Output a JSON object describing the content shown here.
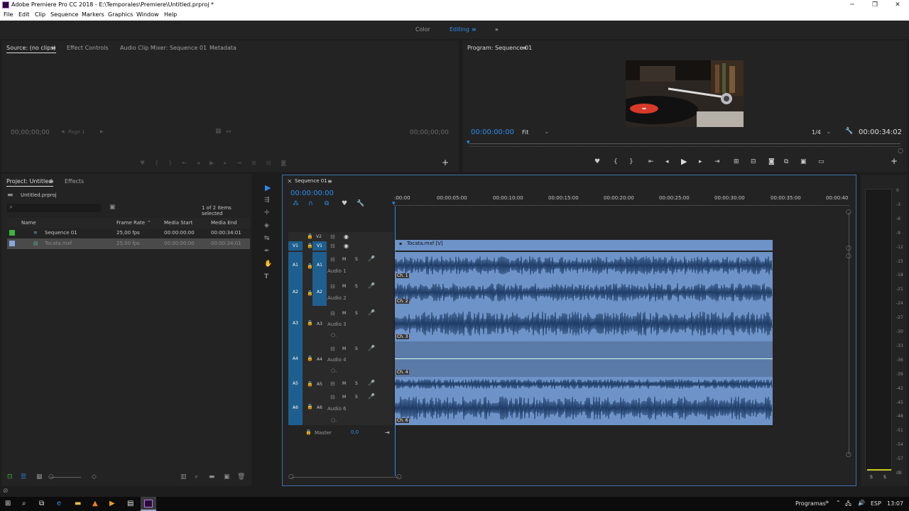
{
  "window": {
    "title": "Adobe Premiere Pro CC 2018 - E:\\Temporales\\Premiere\\Untitled.prproj *"
  },
  "menu": [
    "File",
    "Edit",
    "Clip",
    "Sequence",
    "Markers",
    "Graphics",
    "Window",
    "Help"
  ],
  "workspaces": {
    "color": "Color",
    "editing": "Editing"
  },
  "source": {
    "tabs": [
      "Source: (no clips)",
      "Effect Controls",
      "Audio Clip Mixer: Sequence 01",
      "Metadata"
    ],
    "tc_left": "00;00;00;00",
    "tc_right": "00;00;00;00",
    "page": "Page 1"
  },
  "program": {
    "tab": "Program: Sequence 01",
    "tc_left": "00:00:00:00",
    "fit": "Fit",
    "quality": "1/4",
    "tc_right": "00:00:34:02"
  },
  "project": {
    "tabs": [
      "Project: Untitled",
      "Effects"
    ],
    "file": "Untitled.prproj",
    "count": "1 of 2 items selected",
    "columns": [
      "Name",
      "Frame Rate",
      "Media Start",
      "Media End"
    ],
    "rows": [
      {
        "name": "Sequence 01",
        "rate": "25,00 fps",
        "start": "00:00:00:00",
        "end": "00:00:34:01"
      },
      {
        "name": "Tocata.mxf",
        "rate": "25,00 fps",
        "start": "00:00:00:00",
        "end": "00:00:34:01"
      }
    ]
  },
  "timeline": {
    "tab": "Sequence 01",
    "tc": "00:00:00:00",
    "ruler": [
      ":00:00",
      "00:00:05:00",
      "00:00:10:00",
      "00:00:15:00",
      "00:00:20:00",
      "00:00:25:00",
      "00:00:30:00",
      "00:00:35:00",
      "00:00:40"
    ],
    "video": [
      {
        "src": "",
        "tgt": "V2"
      },
      {
        "src": "V1",
        "tgt": "V1"
      }
    ],
    "audio": [
      {
        "src": "A1",
        "tgt": "A1",
        "name": "Audio 1"
      },
      {
        "src": "A2",
        "tgt": "A2",
        "name": "Audio 2"
      },
      {
        "src": "A3",
        "tgt": "A3",
        "name": "Audio 3"
      },
      {
        "src": "A4",
        "tgt": "A4",
        "name": "Audio 4"
      },
      {
        "src": "A5",
        "tgt": "A5",
        "name": ""
      },
      {
        "src": "A6",
        "tgt": "A6",
        "name": "Audio 6"
      }
    ],
    "master": "Master",
    "master_val": "0,0",
    "clip": "Tocata.mxf [V]",
    "ch": [
      "Ch. 1",
      "Ch. 2",
      "Ch. 3",
      "Ch. 4",
      "Ch. 6"
    ],
    "mute": "M",
    "solo": "S"
  },
  "meter": {
    "ticks": [
      "0",
      "-3",
      "-6",
      "-9",
      "-12",
      "-15",
      "-18",
      "-21",
      "-24",
      "-27",
      "-30",
      "-33",
      "-36",
      "-39",
      "-42",
      "-45",
      "-48",
      "-51",
      "-54",
      "-57",
      "dB"
    ],
    "solo": "S"
  },
  "taskbar": {
    "programs": "Programas",
    "lang": "ESP",
    "time": "13:07"
  },
  "colors": {
    "accent": "#2d8ceb",
    "clip": "#6e93c8",
    "target": "#1e5f8f"
  }
}
